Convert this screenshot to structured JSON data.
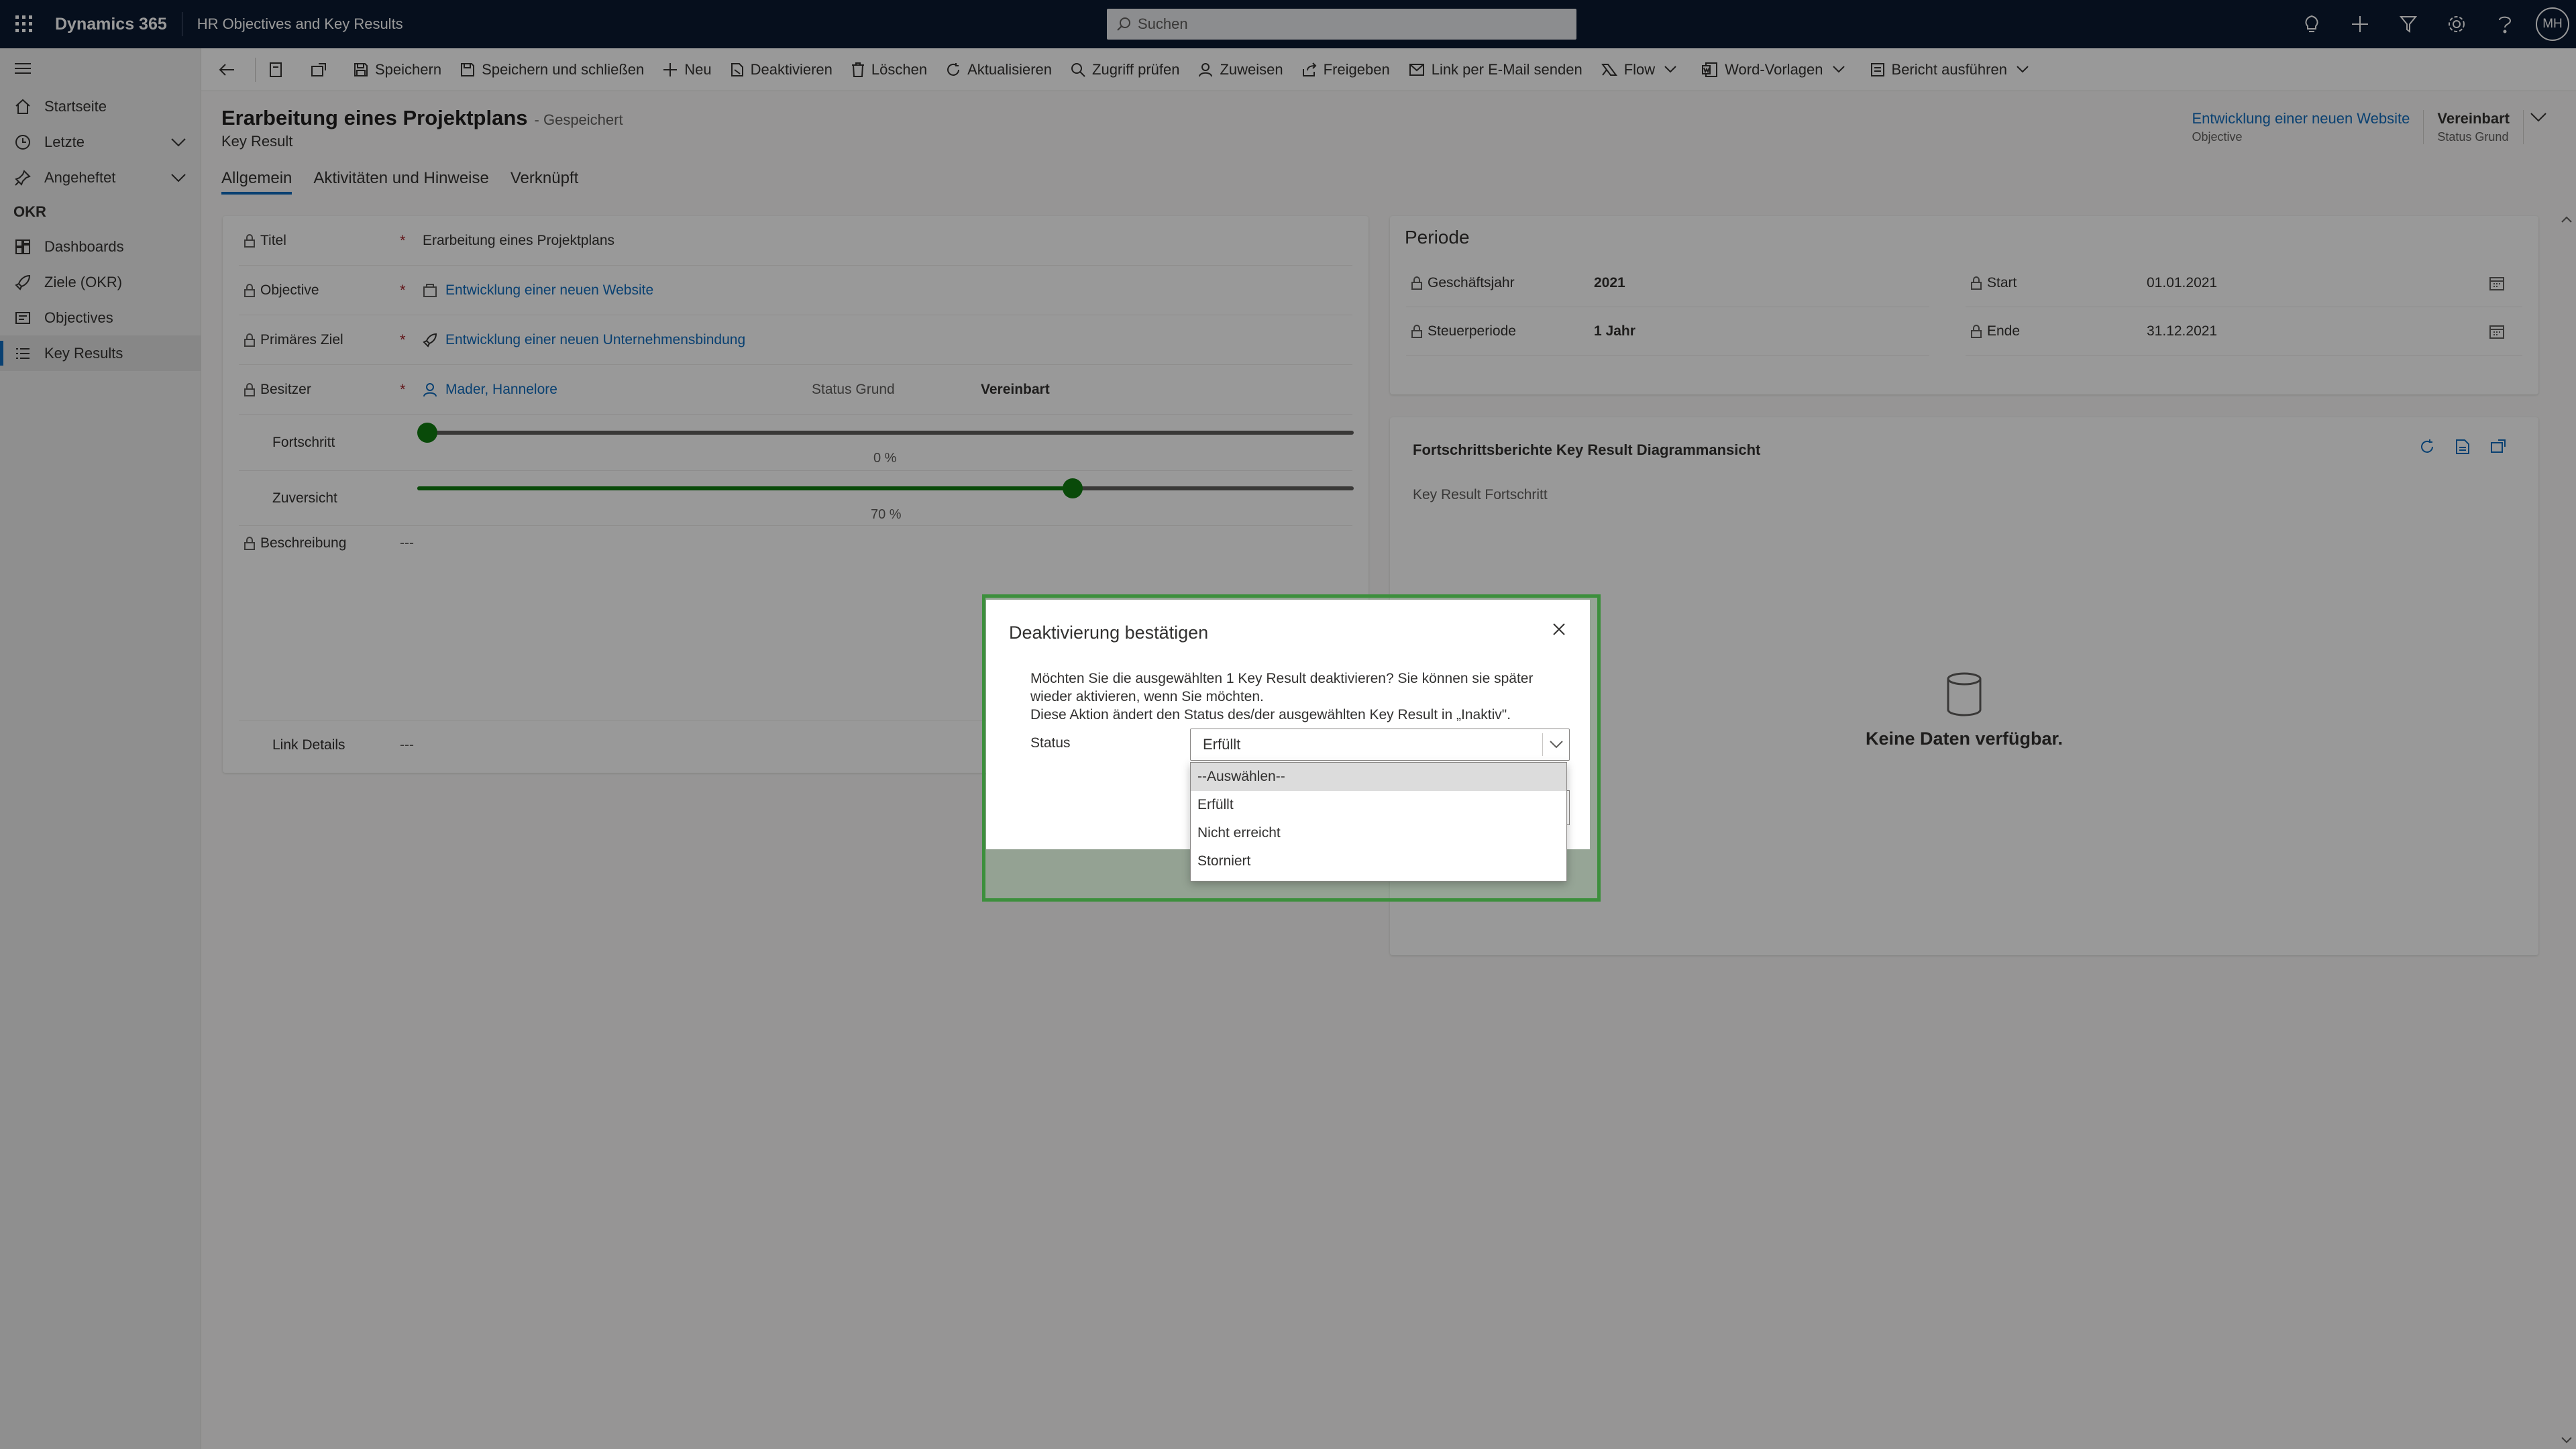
{
  "topbar": {
    "brand": "Dynamics 365",
    "app_name": "HR Objectives and Key Results",
    "search_placeholder": "Suchen",
    "user_initials": "MH"
  },
  "sidebar": {
    "items_top": [
      {
        "label": "Startseite",
        "icon": "home-icon"
      },
      {
        "label": "Letzte",
        "icon": "clock-icon"
      },
      {
        "label": "Angeheftet",
        "icon": "pin-icon"
      }
    ],
    "section": "OKR",
    "items_okr": [
      {
        "label": "Dashboards",
        "icon": "dashboard-icon"
      },
      {
        "label": "Ziele (OKR)",
        "icon": "rocket-icon"
      },
      {
        "label": "Objectives",
        "icon": "objectives-icon"
      },
      {
        "label": "Key Results",
        "icon": "list-icon"
      }
    ]
  },
  "commandbar": {
    "save": "Speichern",
    "save_close": "Speichern und schließen",
    "new": "Neu",
    "deactivate": "Deaktivieren",
    "delete": "Löschen",
    "refresh": "Aktualisieren",
    "check_access": "Zugriff prüfen",
    "assign": "Zuweisen",
    "share": "Freigeben",
    "email_link": "Link per E-Mail senden",
    "flow": "Flow",
    "word_templates": "Word-Vorlagen",
    "run_report": "Bericht ausführen"
  },
  "header": {
    "title": "Erarbeitung eines Projektplans",
    "saved": "- Gespeichert",
    "entity": "Key Result",
    "objective_value": "Entwicklung einer neuen Website",
    "objective_label": "Objective",
    "status_value": "Vereinbart",
    "status_label": "Status Grund"
  },
  "tabs": [
    "Allgemein",
    "Aktivitäten und Hinweise",
    "Verknüpft"
  ],
  "form": {
    "titel_label": "Titel",
    "titel_value": "Erarbeitung eines Projektplans",
    "objective_label": "Objective",
    "objective_value": "Entwicklung einer neuen Website",
    "primary_goal_label": "Primäres Ziel",
    "primary_goal_value": "Entwicklung einer neuen Unternehmensbindung",
    "owner_label": "Besitzer",
    "owner_value": "Mader, Hannelore",
    "status_grund_label": "Status Grund",
    "status_grund_value": "Vereinbart",
    "progress_label": "Fortschritt",
    "progress_value": 0,
    "progress_text": "0 %",
    "confidence_label": "Zuversicht",
    "confidence_value": 70,
    "confidence_text": "70 %",
    "description_label": "Beschreibung",
    "description_value": "---",
    "link_details_label": "Link Details",
    "link_details_value": "---",
    "required_mark": "*"
  },
  "periode": {
    "title": "Periode",
    "fiscal_year_label": "Geschäftsjahr",
    "fiscal_year_value": "2021",
    "fiscal_period_label": "Steuerperiode",
    "fiscal_period_value": "1 Jahr",
    "start_label": "Start",
    "start_value": "01.01.2021",
    "end_label": "Ende",
    "end_value": "31.12.2021"
  },
  "chart_card": {
    "title": "Fortschrittsberichte Key Result Diagrammansicht",
    "subtitle": "Key Result Fortschritt",
    "empty": "Keine Daten verfügbar."
  },
  "dialog": {
    "title": "Deaktivierung bestätigen",
    "message_line1": "Möchten Sie die ausgewählten 1 Key Result deaktivieren? Sie können sie später",
    "message_line2": "wieder aktivieren, wenn Sie möchten.",
    "message_line3": "Diese Aktion ändert den Status des/der ausgewählten Key Result in „Inaktiv\".",
    "status_label": "Status",
    "status_selected": "Erfüllt",
    "options": [
      "--Auswählen--",
      "Erfüllt",
      "Nicht erreicht",
      "Storniert"
    ],
    "highlight_color": "#3c8f3c"
  },
  "colors": {
    "topbar": "#0b1931",
    "accent": "#0f6cbd",
    "slider": "#107c10"
  }
}
